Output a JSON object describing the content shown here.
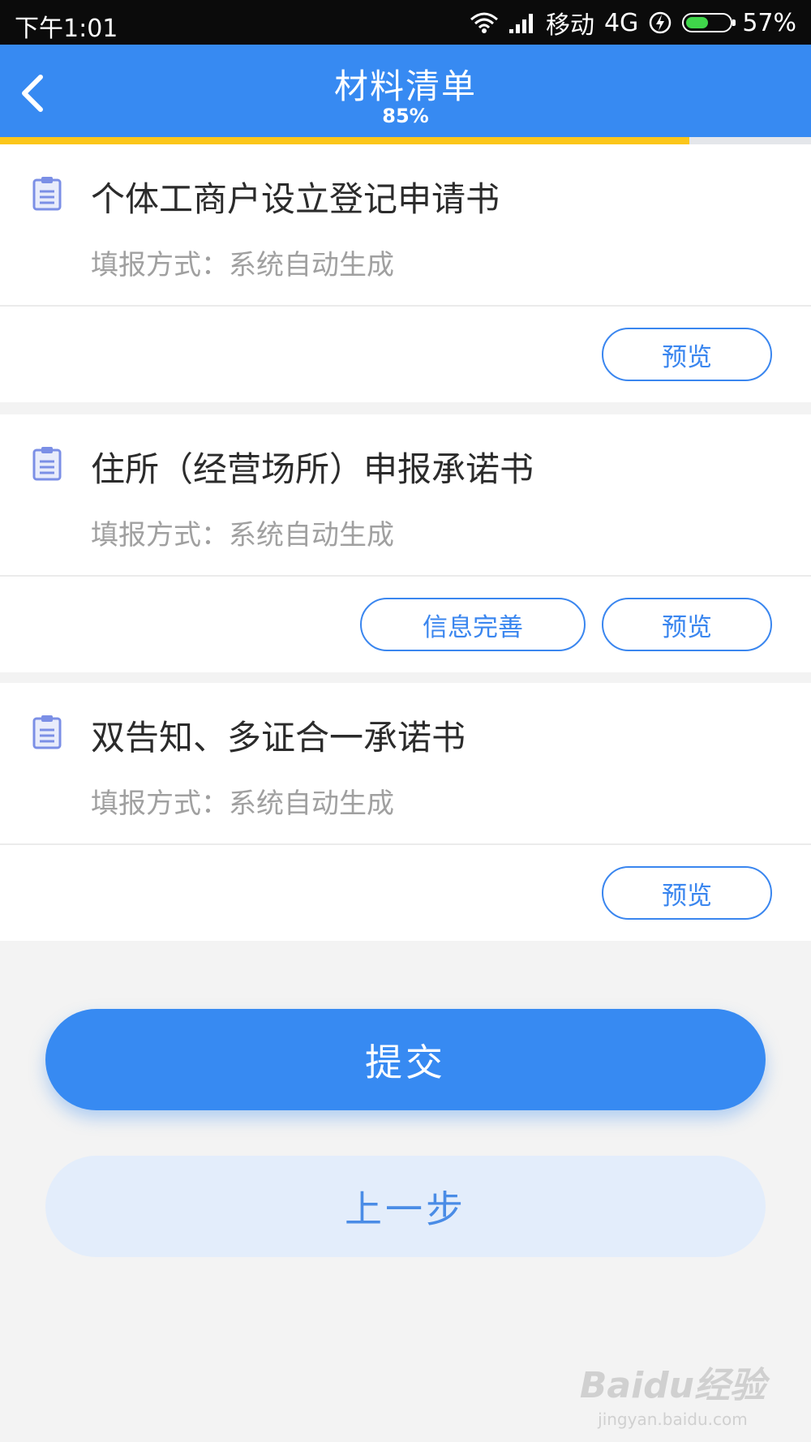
{
  "status_bar": {
    "time": "下午1:01",
    "carrier": "移动",
    "network": "4G",
    "battery": "57%",
    "battery_level": 0.57
  },
  "header": {
    "title": "材料清单",
    "progress_text": "85%",
    "progress_value": 0.85
  },
  "colors": {
    "primary": "#378af2",
    "progress": "#fbc61a",
    "secondary_bg": "#e3edfb"
  },
  "items": [
    {
      "title": "个体工商户设立登记申请书",
      "method": "填报方式：系统自动生成",
      "buttons": [
        "预览"
      ],
      "icon": "clipboard-icon"
    },
    {
      "title": "住所（经营场所）申报承诺书",
      "method": "填报方式：系统自动生成",
      "buttons": [
        "信息完善",
        "预览"
      ],
      "icon": "clipboard-icon"
    },
    {
      "title": "双告知、多证合一承诺书",
      "method": "填报方式：系统自动生成",
      "buttons": [
        "预览"
      ],
      "icon": "clipboard-icon"
    }
  ],
  "actions": {
    "submit_label": "提交",
    "prev_label": "上一步"
  },
  "watermark": {
    "logo": "Baidu经验",
    "url": "jingyan.baidu.com"
  }
}
